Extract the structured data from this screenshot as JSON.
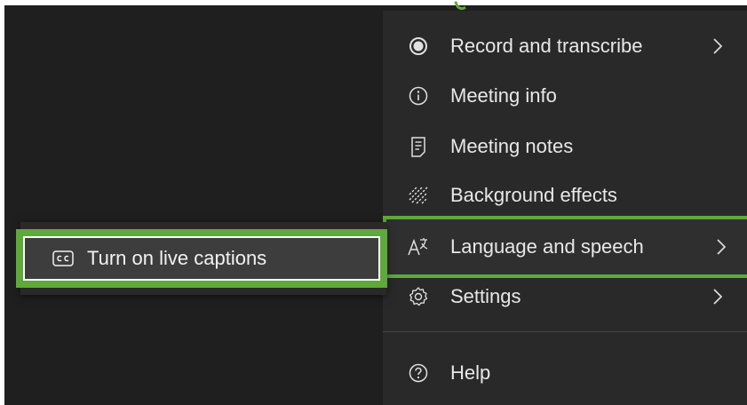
{
  "menu": {
    "items": [
      {
        "label": "Record and transcribe",
        "icon": "record-icon",
        "has_submenu": true
      },
      {
        "label": "Meeting info",
        "icon": "info-icon",
        "has_submenu": false
      },
      {
        "label": "Meeting notes",
        "icon": "notes-icon",
        "has_submenu": false
      },
      {
        "label": "Background effects",
        "icon": "background-effects-icon",
        "has_submenu": false
      },
      {
        "label": "Language and speech",
        "icon": "language-icon",
        "has_submenu": true
      },
      {
        "label": "Settings",
        "icon": "gear-icon",
        "has_submenu": true
      },
      {
        "label": "Help",
        "icon": "help-icon",
        "has_submenu": false
      }
    ]
  },
  "submenu": {
    "items": [
      {
        "label": "Turn on live captions",
        "icon": "closed-captions-icon"
      }
    ]
  },
  "colors": {
    "highlight": "#5fa83a",
    "menu_bg": "#292929",
    "stage_bg": "#1f1f1f",
    "text": "#e8e8e8"
  }
}
